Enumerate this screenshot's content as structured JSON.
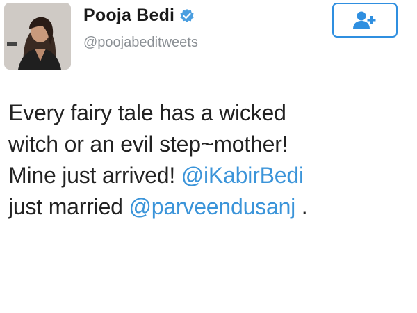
{
  "user": {
    "display_name": "Pooja Bedi",
    "handle": "@poojabeditweets",
    "verified": true,
    "avatar_icon": "profile-photo",
    "verified_icon": "verified-badge-icon"
  },
  "follow_button": {
    "icon": "follow-user-icon",
    "color": "#2f8fe0"
  },
  "tweet": {
    "line1": "Every fairy tale has a wicked",
    "line2": "witch or an evil step~mother!",
    "line3_text": "Mine just arrived! ",
    "mention1": "@iKabirBedi",
    "line4_text": "just married ",
    "mention2": "@parveendusanj",
    "line4_end": " ."
  },
  "colors": {
    "mention": "#3b94d9",
    "handle": "#8a8f94",
    "text": "#222222"
  }
}
